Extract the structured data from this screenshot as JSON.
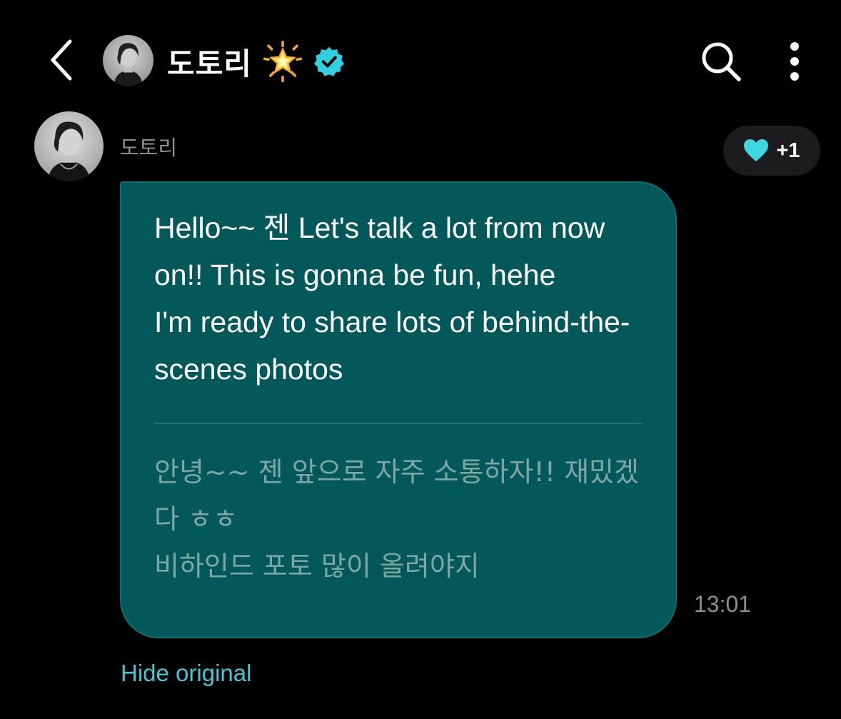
{
  "header": {
    "title": "도토리",
    "back_icon": "chevron-left-icon",
    "star_emoji": "glowing-star-icon",
    "verified_icon": "verified-badge-icon",
    "search_icon": "search-icon",
    "more_icon": "more-vertical-icon"
  },
  "message": {
    "sender_name": "도토리",
    "translated_text": "Hello~~ 젠 Let's talk a lot from now on!! This is gonna be fun, hehe\nI'm ready to share lots of behind-the-scenes photos",
    "original_text": "안녕~~ 젠 앞으로 자주 소통하자!! 재밌겠다 ㅎㅎ\n비하인드 포토 많이 올려야지",
    "time": "13:01",
    "hide_original_label": "Hide original",
    "reaction": {
      "icon": "heart-icon",
      "count": "+1"
    }
  },
  "colors": {
    "background": "#000000",
    "bubble": "#03595a",
    "accent": "#3ec9d6",
    "verified": "#2fd0e0",
    "muted_text": "#8e8e93",
    "original_text": "#7fa5a5"
  }
}
